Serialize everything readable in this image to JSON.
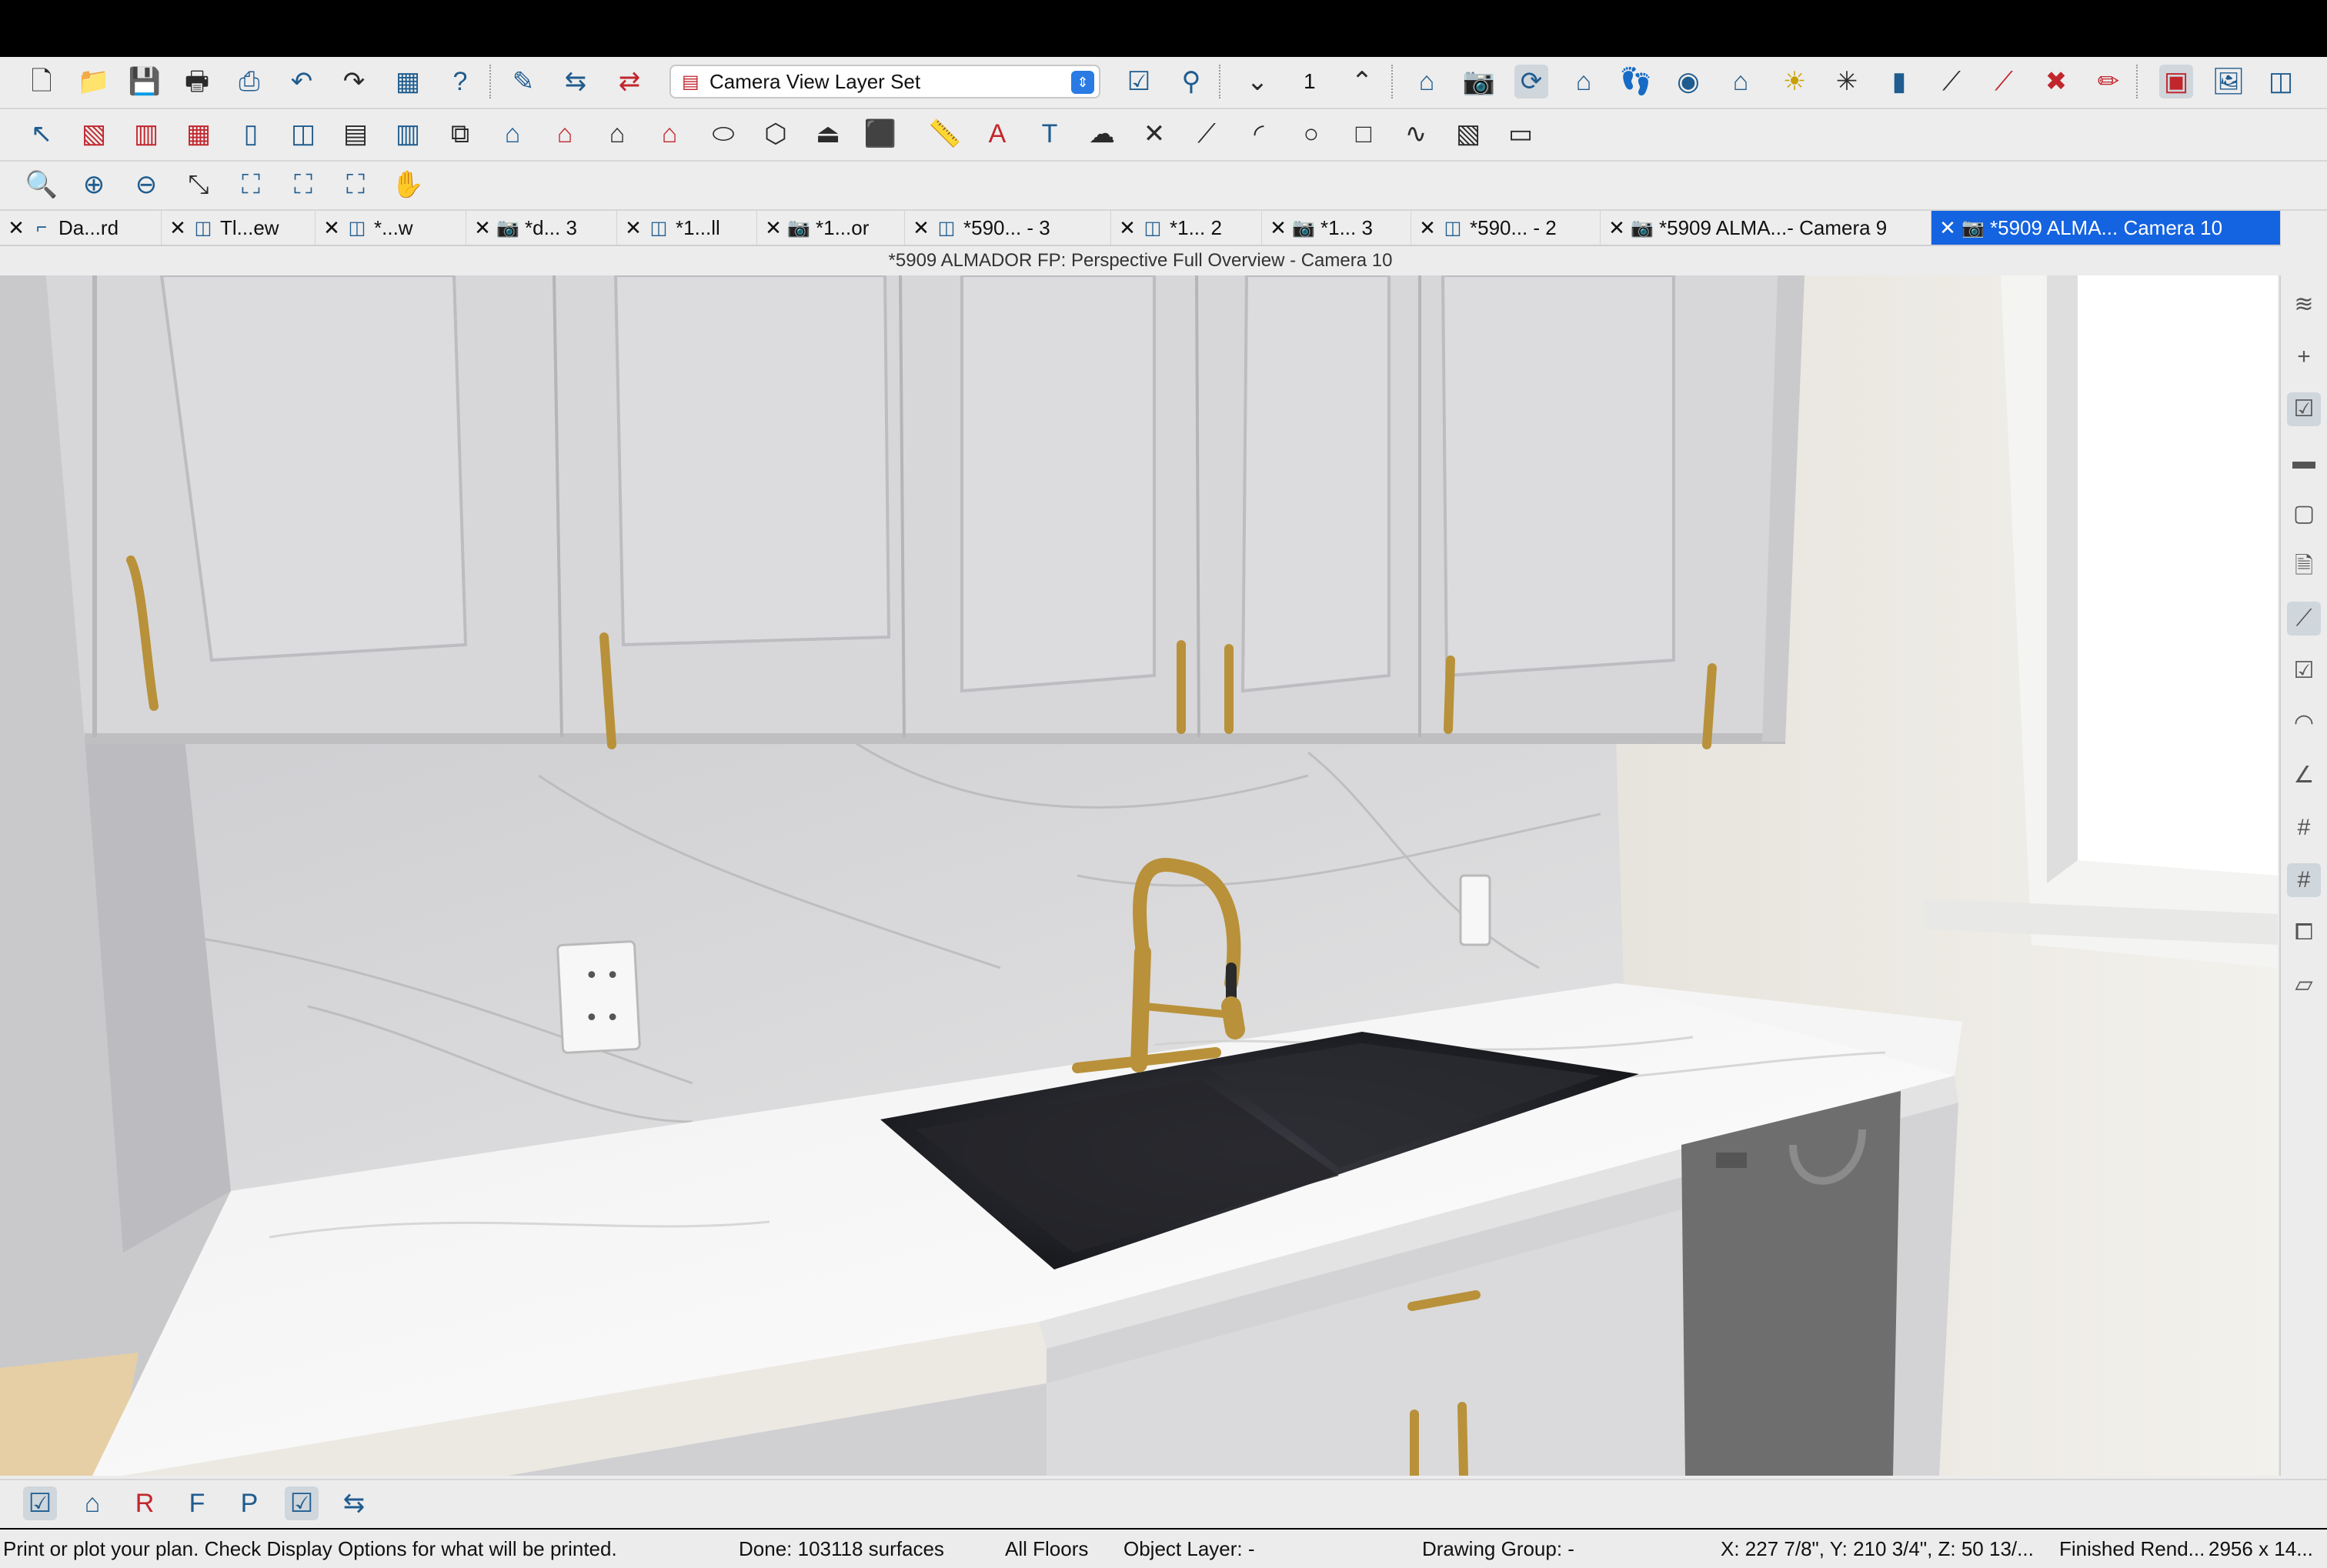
{
  "toolbar": {
    "layer_set": "Camera View Layer Set",
    "floor_number": "1"
  },
  "tabs": [
    {
      "label": "Da...rd",
      "icon": "layout-icon"
    },
    {
      "label": "Tl...ew",
      "icon": "plan-icon"
    },
    {
      "label": "*...w",
      "icon": "plan-icon"
    },
    {
      "label": "*d... 3",
      "icon": "camera-icon"
    },
    {
      "label": "*1...ll",
      "icon": "plan-icon"
    },
    {
      "label": "*1...or",
      "icon": "camera-icon"
    },
    {
      "label": "*590... - 3",
      "icon": "plan-icon"
    },
    {
      "label": "*1... 2",
      "icon": "plan-icon"
    },
    {
      "label": "*1... 3",
      "icon": "camera-icon"
    },
    {
      "label": "*590... - 2",
      "icon": "plan-icon"
    },
    {
      "label": "*5909 ALMA...- Camera 9",
      "icon": "camera-icon"
    },
    {
      "label": "*5909 ALMA... Camera 10",
      "icon": "camera-icon",
      "active": true
    }
  ],
  "window_title": "*5909 ALMADOR FP: Perspective Full Overview - Camera 10",
  "status": {
    "message": "Print or plot your plan. Check Display Options for what will be printed.",
    "done": "Done:  103118 surfaces",
    "floors": "All Floors",
    "object_layer": "Object Layer: -",
    "drawing_group": "Drawing Group: -",
    "coords": "X: 227 7/8\", Y: 210 3/4\", Z: 50 13/...",
    "render": "Finished Rend...",
    "size": "2956 x 14..."
  },
  "colors": {
    "active_tab": "#1463e0",
    "icon_blue": "#1f5c8f",
    "icon_red": "#c2262d",
    "brass": "#b8913a"
  }
}
